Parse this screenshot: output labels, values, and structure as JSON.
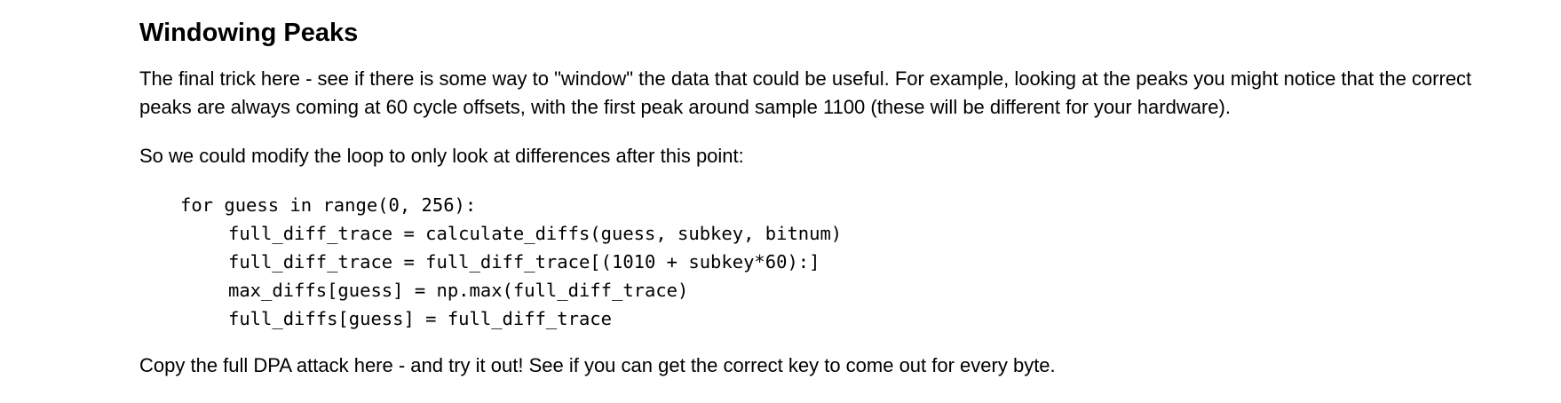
{
  "heading": "Windowing Peaks",
  "paragraph1": {
    "line1": "The final trick here - see if there is some way to \"window\" the data that could be useful. For example, looking at the peaks you might notice that the correct",
    "line2": "peaks are always coming at 60 cycle offsets, with the first peak around sample 1100 (these will be different for your hardware)."
  },
  "paragraph2": "So we could modify the loop to only look at differences after this point:",
  "code": {
    "lines": [
      "for guess in range(0, 256):",
      "full_diff_trace = calculate_diffs(guess, subkey, bitnum)",
      "full_diff_trace = full_diff_trace[(1010 + subkey*60):]",
      "max_diffs[guess] = np.max(full_diff_trace)",
      "full_diffs[guess] = full_diff_trace"
    ]
  },
  "paragraph3": "Copy the full DPA attack here - and try it out! See if you can get the correct key to come out for every byte."
}
